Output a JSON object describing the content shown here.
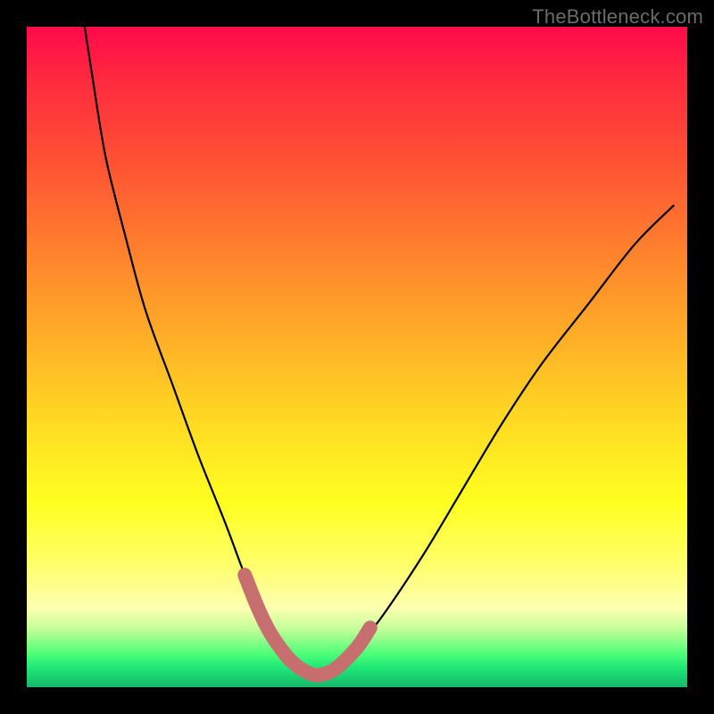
{
  "watermark": "TheBottleneck.com",
  "colors": {
    "frame": "#000000",
    "curve": "#000000",
    "marker": "#c76f6f",
    "gradient_stops": [
      "#ff0a4a",
      "#ff2a3f",
      "#ff5034",
      "#ff7a2e",
      "#ffa428",
      "#ffd423",
      "#ffff20",
      "#ffff70",
      "#fdffb0",
      "#c7ff9a",
      "#8cff88",
      "#4cff78",
      "#1fe877",
      "#15b86a"
    ]
  },
  "chart_data": {
    "type": "line",
    "title": "",
    "xlabel": "",
    "ylabel": "",
    "xlim": [
      0,
      100
    ],
    "ylim": [
      0,
      100
    ],
    "series": [
      {
        "name": "bottleneck-curve",
        "x": [
          8,
          10,
          12,
          15,
          18,
          22,
          26,
          30,
          33,
          35,
          37,
          40,
          43,
          45,
          47,
          50,
          54,
          60,
          66,
          72,
          78,
          85,
          92,
          98
        ],
        "values": [
          105,
          92,
          80,
          68,
          57,
          46,
          35,
          25,
          17,
          12,
          8,
          4,
          2,
          2,
          3,
          6,
          11,
          20,
          30,
          40,
          49,
          58,
          67,
          73
        ]
      }
    ],
    "markers": {
      "name": "bottom-segment",
      "x": [
        33,
        35,
        37,
        40,
        43,
        45,
        47,
        50,
        52
      ],
      "values": [
        17,
        12,
        8,
        4,
        2,
        2,
        3,
        6,
        9
      ]
    }
  }
}
